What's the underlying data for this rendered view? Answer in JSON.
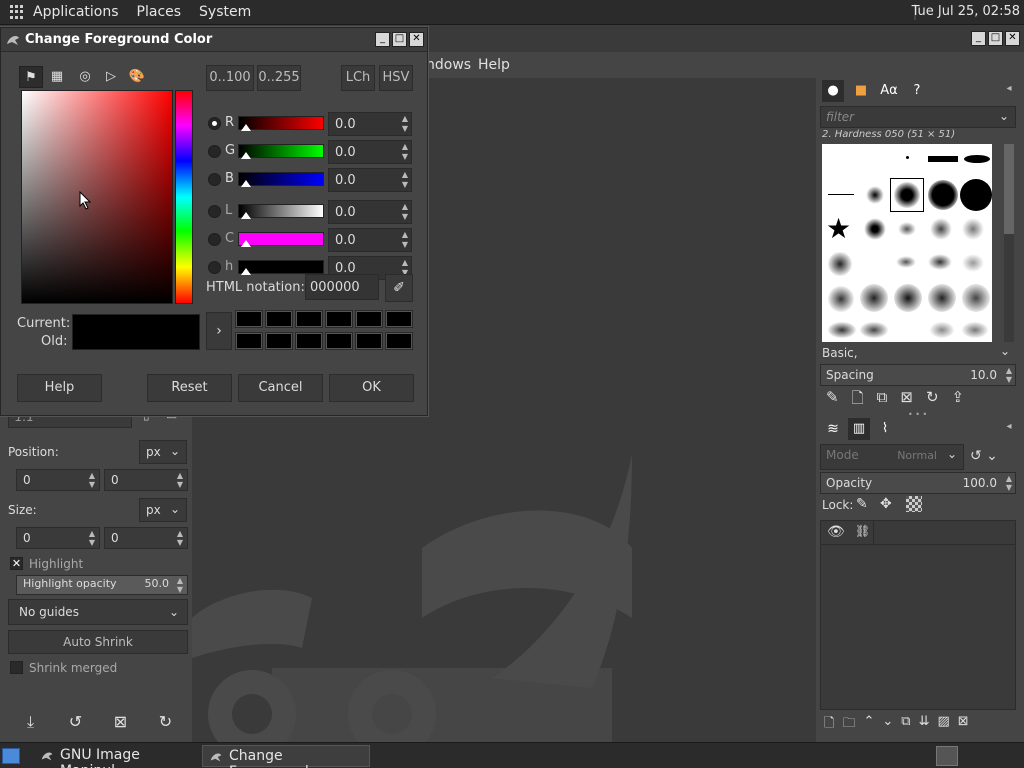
{
  "top_panel": {
    "menus": [
      "Applications",
      "Places",
      "System"
    ],
    "clock": "Tue Jul 25, 02:58"
  },
  "gimp_menubar": {
    "visible_items": [
      "ndows",
      "Help"
    ]
  },
  "color_dialog": {
    "title": "Change Foreground Color",
    "selector_tabs": [
      "gimp-icon",
      "cmyk-icon",
      "watercolor-icon",
      "triangle-icon",
      "palette-icon"
    ],
    "mode_buttons": [
      "0..100",
      "0..255",
      "LCh",
      "HSV"
    ],
    "channels": [
      {
        "label": "R",
        "value": "0.0",
        "active": true,
        "gradient": [
          "#000000",
          "#ff0000"
        ]
      },
      {
        "label": "G",
        "value": "0.0",
        "active": false,
        "gradient": [
          "#000000",
          "#00ff00"
        ]
      },
      {
        "label": "B",
        "value": "0.0",
        "active": false,
        "gradient": [
          "#000000",
          "#0000ff"
        ]
      },
      {
        "label": "L",
        "value": "0.0",
        "active": false,
        "gradient": [
          "#000000",
          "#ffffff"
        ]
      },
      {
        "label": "C",
        "value": "0.0",
        "active": false,
        "gradient": [
          "#ff00ff",
          "#ff00ff"
        ]
      },
      {
        "label": "h",
        "value": "0.0",
        "active": false,
        "gradient": [
          "#000000",
          "#000000"
        ]
      }
    ],
    "html_notation_label": "HTML notation:",
    "html_notation_value": "000000",
    "current_label": "Current:",
    "old_label": "Old:",
    "current_color": "#000000",
    "buttons": {
      "help": "Help",
      "reset": "Reset",
      "cancel": "Cancel",
      "ok": "OK"
    }
  },
  "left_dock": {
    "ratio_value": "1:1",
    "position_label": "Position:",
    "position_unit": "px",
    "position_x": "0",
    "position_y": "0",
    "size_label": "Size:",
    "size_unit": "px",
    "size_w": "0",
    "size_h": "0",
    "highlight_label": "Highlight",
    "highlight_opacity_label": "Highlight opacity",
    "highlight_opacity_value": "50.0",
    "guides_value": "No guides",
    "auto_shrink_label": "Auto Shrink",
    "shrink_merged_label": "Shrink merged"
  },
  "right_dock": {
    "filter_placeholder": "filter",
    "brush_name": "2. Hardness 050 (51 × 51)",
    "brush_set": "Basic,",
    "spacing_label": "Spacing",
    "spacing_value": "10.0",
    "mode_label": "Mode",
    "mode_value": "Normal",
    "opacity_label": "Opacity",
    "opacity_value": "100.0",
    "lock_label": "Lock:"
  },
  "taskbar": {
    "tasks": [
      {
        "label": "GNU Image Manipul...",
        "active": false
      },
      {
        "label": "Change Foreground...",
        "active": true
      }
    ]
  }
}
